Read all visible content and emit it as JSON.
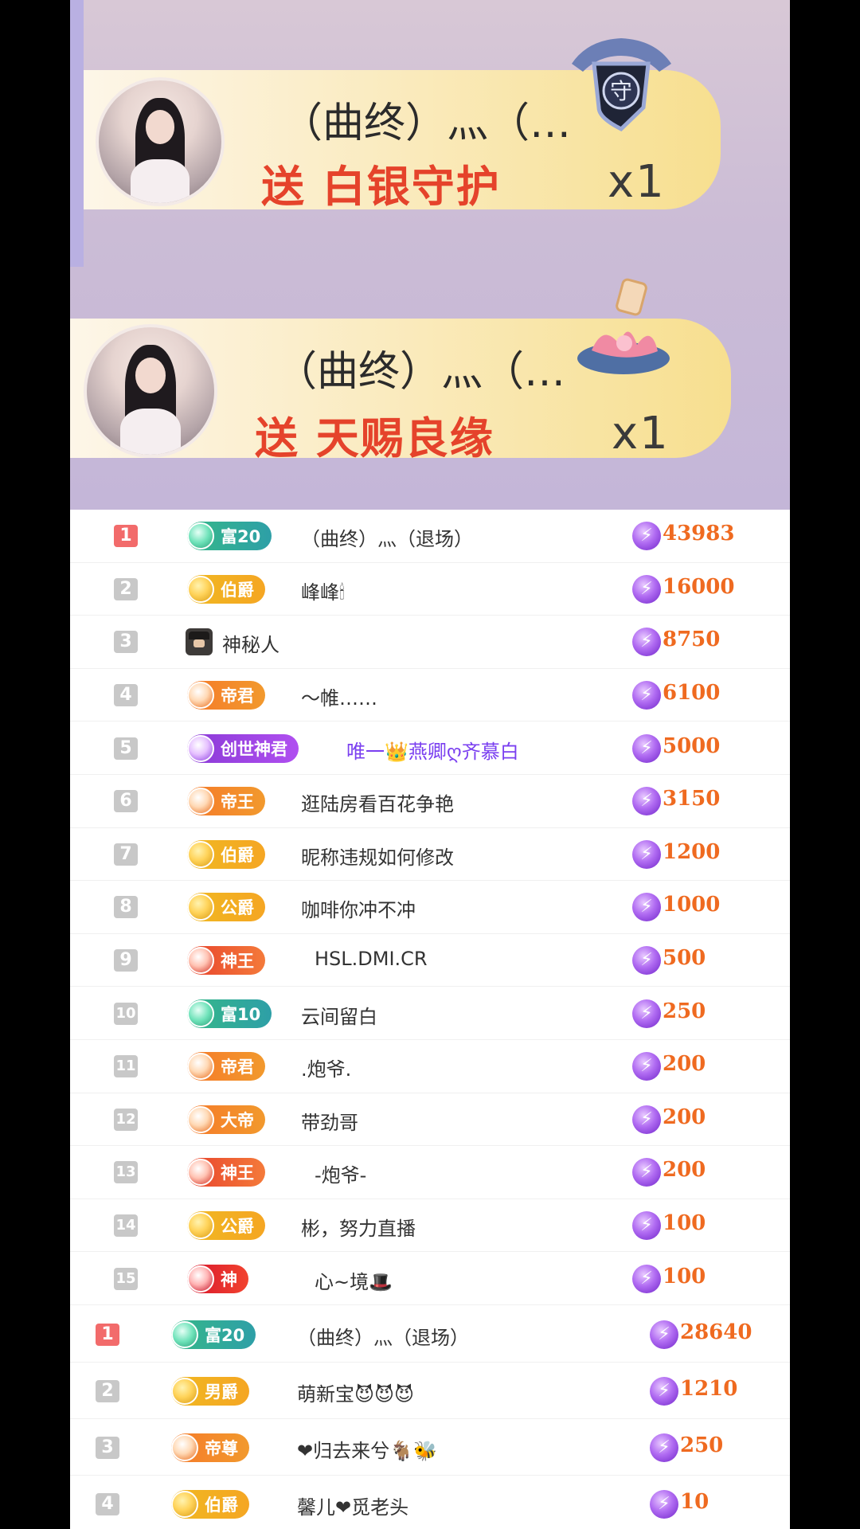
{
  "gifts": [
    {
      "giver": "（曲终）灬（…",
      "gift": "送 白银守护",
      "count": "x1",
      "icon": "silver-guard-shield-icon"
    },
    {
      "giver": "（曲终）灬（…",
      "gift": "送 天赐良缘",
      "count": "x1",
      "icon": "lotus-lantern-icon"
    }
  ],
  "list1": [
    {
      "rank": "1",
      "badge": "富20",
      "badge_style": "fu",
      "name": "（曲终）灬（退场）",
      "score": "43983"
    },
    {
      "rank": "2",
      "badge": "伯爵",
      "badge_style": "gold",
      "name": "峰峰🕯",
      "score": "16000"
    },
    {
      "rank": "3",
      "badge": "",
      "badge_style": "spy",
      "name": "神秘人",
      "score": "8750"
    },
    {
      "rank": "4",
      "badge": "帝君",
      "badge_style": "orange",
      "name": "～帷……",
      "score": "6100"
    },
    {
      "rank": "5",
      "badge": "创世神君",
      "badge_style": "purple",
      "name": "唯一👑燕卿ღ齐慕白",
      "score": "5000"
    },
    {
      "rank": "6",
      "badge": "帝王",
      "badge_style": "orange",
      "name": "逛陆房看百花争艳",
      "score": "3150"
    },
    {
      "rank": "7",
      "badge": "伯爵",
      "badge_style": "gold",
      "name": "昵称违规如何修改",
      "score": "1200"
    },
    {
      "rank": "8",
      "badge": "公爵",
      "badge_style": "gold",
      "name": "咖啡你冲不冲",
      "score": "1000"
    },
    {
      "rank": "9",
      "badge": "神王",
      "badge_style": "red",
      "name": "HSL.DMI.CR",
      "score": "500"
    },
    {
      "rank": "10",
      "badge": "富10",
      "badge_style": "fu",
      "name": "云间留白",
      "score": "250"
    },
    {
      "rank": "11",
      "badge": "帝君",
      "badge_style": "orange",
      "name": ".炮爷.",
      "score": "200"
    },
    {
      "rank": "12",
      "badge": "大帝",
      "badge_style": "orange",
      "name": "带劲哥",
      "score": "200"
    },
    {
      "rank": "13",
      "badge": "神王",
      "badge_style": "red",
      "name": "-炮爷-",
      "score": "200"
    },
    {
      "rank": "14",
      "badge": "公爵",
      "badge_style": "gold",
      "name": "彬，努力直播",
      "score": "100"
    },
    {
      "rank": "15",
      "badge": "神",
      "badge_style": "shen",
      "name": "心~境🎩",
      "score": "100"
    }
  ],
  "list2": [
    {
      "rank": "1",
      "badge": "富20",
      "badge_style": "fu",
      "name": "（曲终）灬（退场）",
      "score": "28640"
    },
    {
      "rank": "2",
      "badge": "男爵",
      "badge_style": "gold",
      "name": "萌新宝😈😈😈",
      "score": "1210"
    },
    {
      "rank": "3",
      "badge": "帝尊",
      "badge_style": "orange",
      "name": "❤归去来兮🐐🐝",
      "score": "250"
    },
    {
      "rank": "4",
      "badge": "伯爵",
      "badge_style": "gold",
      "name": "馨儿❤觅老头",
      "score": "10"
    }
  ],
  "icons": {
    "coin": "lightning-coin-icon"
  },
  "colors": {
    "score": "#ef6a20",
    "gift_text": "#e5432b",
    "rank_top": "#f26b6b"
  }
}
